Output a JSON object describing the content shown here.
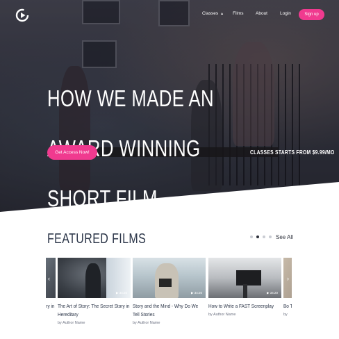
{
  "nav": {
    "items": [
      {
        "label": "Classes"
      },
      {
        "label": "Films"
      },
      {
        "label": "About"
      },
      {
        "label": "Login"
      }
    ],
    "signup_label": "Sign up",
    "icons": {
      "logo": "play-logo-icon",
      "classes_caret": "caret-up-icon"
    }
  },
  "hero": {
    "title_lines": [
      "HOW WE MADE AN",
      "AWARD WINNING",
      "SHORT FILM"
    ],
    "cta_label": "Get Access Now!",
    "classes_note": "CLASSES STARTS FROM $9.99/MO"
  },
  "featured": {
    "title": "FEATURED FILMS",
    "see_all_label": "See All",
    "pagination": {
      "count": 4,
      "active_index": 1
    },
    "cards": [
      {
        "title": "The Art of Story: The Secret Story in Hereditary",
        "author": "",
        "duration": ""
      },
      {
        "title": "The Art of Story: The Secret Story in Hereditary",
        "author": "by Author Name",
        "duration": "34:20"
      },
      {
        "title": "Story and the Mind - Why Do We Tell Stories",
        "author": "by Author Name",
        "duration": "34:20"
      },
      {
        "title": "How to Write a FAST Screenplay",
        "author": "by Author Name",
        "duration": "34:20"
      },
      {
        "title": "Bo Tal",
        "author": "by",
        "duration": ""
      }
    ],
    "icons": {
      "prev": "chevron-left-icon",
      "next": "chevron-right-icon",
      "duration": "play-icon"
    }
  },
  "colors": {
    "accent": "#f03a8f",
    "heading": "#2b3548",
    "hero_overlay": "#30323b"
  }
}
